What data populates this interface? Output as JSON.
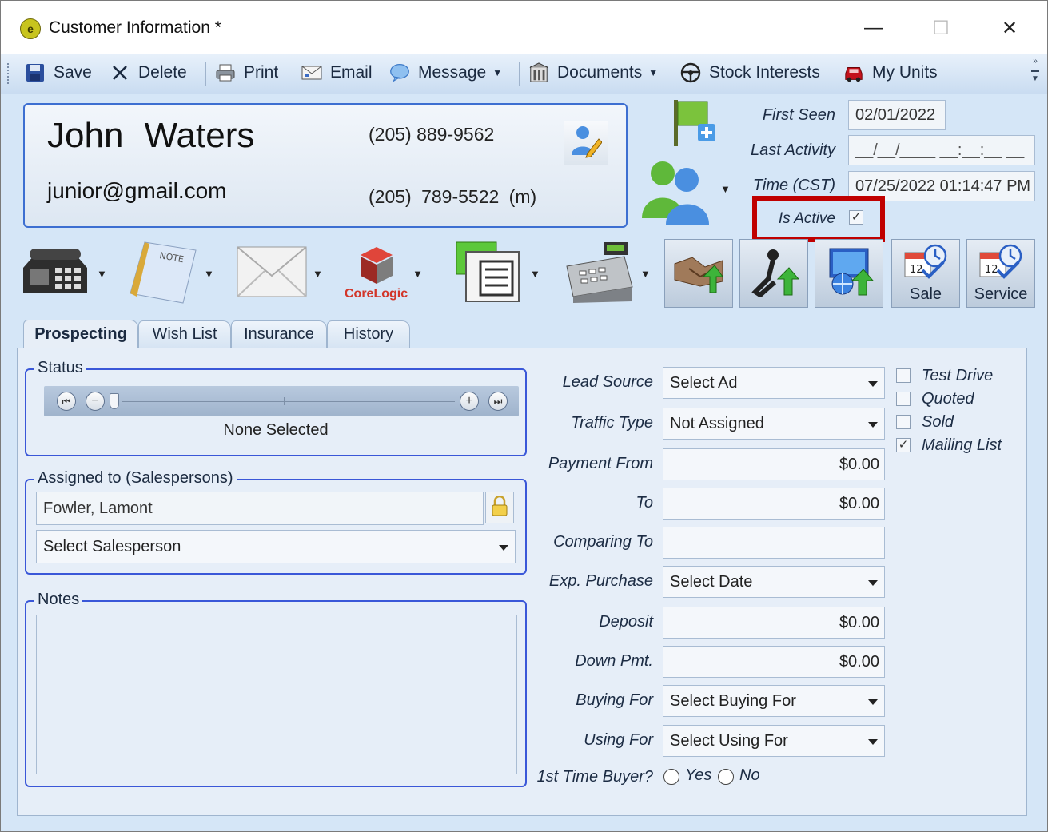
{
  "window": {
    "title": "Customer Information *",
    "minimize": "—",
    "maximize": "☐",
    "close": "✕"
  },
  "toolbar": {
    "save": "Save",
    "delete": "Delete",
    "print": "Print",
    "email": "Email",
    "message": "Message",
    "documents": "Documents",
    "stock_interests": "Stock Interests",
    "my_units": "My Units"
  },
  "customer": {
    "name": "John Waters",
    "email": "junior@gmail.com",
    "phone_home": "(205) 889-9562",
    "phone_mobile": "(205) 789-5522 (m)"
  },
  "info": {
    "first_seen_label": "First Seen",
    "first_seen": "02/01/2022",
    "last_activity_label": "Last Activity",
    "last_activity": "__/__/____ __:__:__ __",
    "time_label": "Time (CST)",
    "time": "07/25/2022 01:14:47 PM",
    "is_active_label": "Is Active",
    "is_active_check": "✓"
  },
  "actions": {
    "corelogic": "CoreLogic",
    "sale": "Sale",
    "service": "Service"
  },
  "tabs": [
    {
      "label": "Prospecting"
    },
    {
      "label": "Wish List"
    },
    {
      "label": "Insurance"
    },
    {
      "label": "History"
    }
  ],
  "status": {
    "title": "Status",
    "value": "None Selected"
  },
  "assigned": {
    "title": "Assigned to (Salespersons)",
    "primary": "Fowler, Lamont",
    "secondary": "Select Salesperson"
  },
  "notes": {
    "title": "Notes"
  },
  "form": {
    "lead_source_label": "Lead Source",
    "lead_source": "Select Ad",
    "traffic_type_label": "Traffic Type",
    "traffic_type": "Not Assigned",
    "payment_from_label": "Payment From",
    "payment_from": "$0.00",
    "to_label": "To",
    "to": "$0.00",
    "comparing_to_label": "Comparing To",
    "comparing_to": "",
    "exp_purchase_label": "Exp. Purchase",
    "exp_purchase": "Select Date",
    "deposit_label": "Deposit",
    "deposit": "$0.00",
    "down_pmt_label": "Down Pmt.",
    "down_pmt": "$0.00",
    "buying_for_label": "Buying For",
    "buying_for": "Select Buying For",
    "using_for_label": "Using For",
    "using_for": "Select Using For",
    "first_time_label": "1st Time Buyer?",
    "yes": "Yes",
    "no": "No"
  },
  "checklist": {
    "test_drive": "Test Drive",
    "quoted": "Quoted",
    "sold": "Sold",
    "mailing_list": "Mailing List",
    "mailing_check": "✓"
  },
  "colors": {
    "window_bg": "#d5e6f7",
    "group_border": "#3a57d8",
    "highlight": "#c00000"
  }
}
